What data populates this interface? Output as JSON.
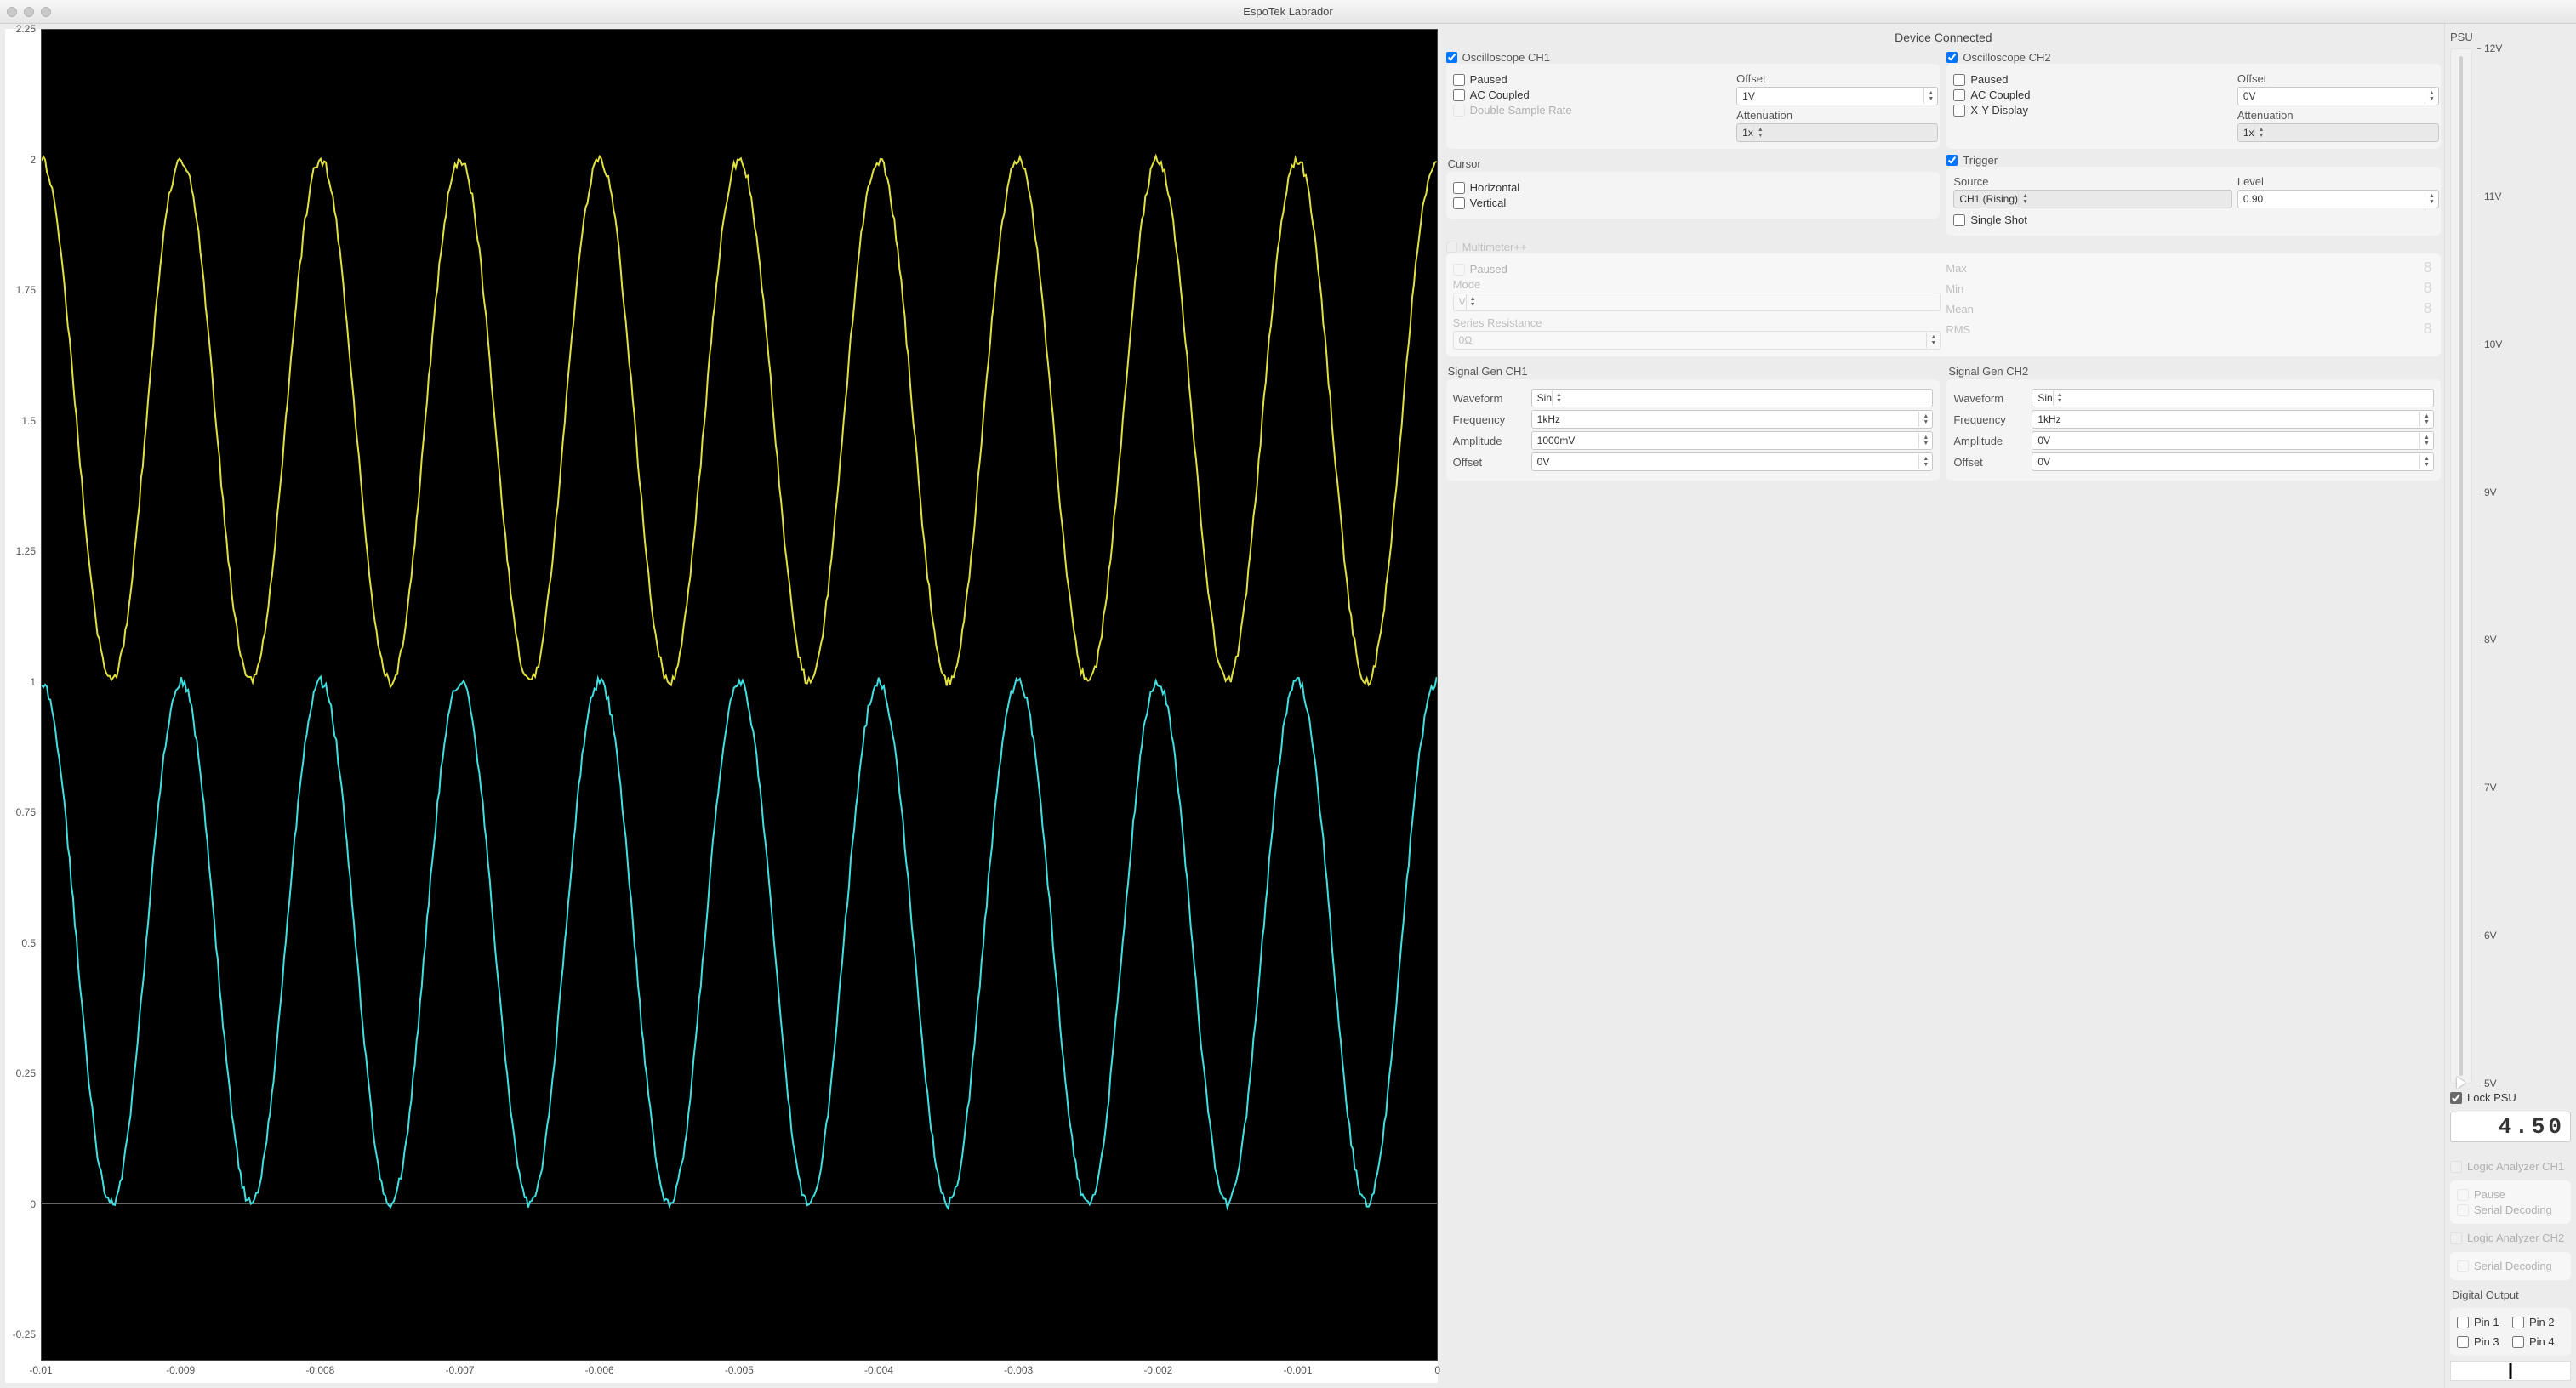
{
  "window": {
    "title": "EspoTek Labrador"
  },
  "status": "Device Connected",
  "scope": {
    "ch1": {
      "title": "Oscilloscope CH1",
      "enabled": true,
      "paused_label": "Paused",
      "ac_label": "AC Coupled",
      "dsr_label": "Double Sample Rate",
      "offset_label": "Offset",
      "offset": "1V",
      "atten_label": "Attenuation",
      "atten": "1x"
    },
    "ch2": {
      "title": "Oscilloscope CH2",
      "enabled": true,
      "paused_label": "Paused",
      "ac_label": "AC Coupled",
      "xy_label": "X-Y Display",
      "offset_label": "Offset",
      "offset": "0V",
      "atten_label": "Attenuation",
      "atten": "1x"
    }
  },
  "cursor": {
    "title": "Cursor",
    "horizontal": "Horizontal",
    "vertical": "Vertical"
  },
  "trigger": {
    "title": "Trigger",
    "enabled": true,
    "source_label": "Source",
    "source": "CH1 (Rising)",
    "level_label": "Level",
    "level": "0.90",
    "single_shot": "Single Shot"
  },
  "mm": {
    "title": "Multimeter++",
    "paused": "Paused",
    "mode_label": "Mode",
    "mode": "V",
    "series_label": "Series Resistance",
    "series": "0Ω",
    "max": "Max",
    "min": "Min",
    "mean": "Mean",
    "rms": "RMS",
    "digit": "8"
  },
  "sig": {
    "ch1": {
      "title": "Signal Gen CH1",
      "waveform_label": "Waveform",
      "waveform": "Sin",
      "freq_label": "Frequency",
      "freq": "1kHz",
      "amp_label": "Amplitude",
      "amp": "1000mV",
      "offset_label": "Offset",
      "offset": "0V"
    },
    "ch2": {
      "title": "Signal Gen CH2",
      "waveform_label": "Waveform",
      "waveform": "Sin",
      "freq_label": "Frequency",
      "freq": "1kHz",
      "amp_label": "Amplitude",
      "amp": "0V",
      "offset_label": "Offset",
      "offset": "0V"
    }
  },
  "psu": {
    "title": "PSU",
    "ticks": [
      "12V",
      "11V",
      "10V",
      "9V",
      "8V",
      "7V",
      "6V",
      "5V"
    ],
    "lock": "Lock PSU",
    "lcd": "4.50"
  },
  "la": {
    "ch1_title": "Logic Analyzer CH1",
    "pause": "Pause",
    "serial": "Serial Decoding",
    "ch2_title": "Logic Analyzer CH2"
  },
  "dout": {
    "title": "Digital Output",
    "p1": "Pin 1",
    "p2": "Pin 2",
    "p3": "Pin 3",
    "p4": "Pin 4"
  },
  "chart_data": {
    "type": "line",
    "xlabel": "",
    "ylabel": "",
    "xlim": [
      -0.01,
      0
    ],
    "ylim": [
      -0.3,
      2.25
    ],
    "x_ticks": [
      -0.01,
      -0.009,
      -0.008,
      -0.007,
      -0.006,
      -0.005,
      -0.004,
      -0.003,
      -0.002,
      -0.001,
      0
    ],
    "y_ticks": [
      -0.25,
      0,
      0.25,
      0.5,
      0.75,
      1,
      1.25,
      1.5,
      1.75,
      2,
      2.25
    ],
    "series": [
      {
        "name": "CH1",
        "color": "#e0e040",
        "wave": "sine",
        "freq_hz": 1000,
        "amplitude_v": 0.5,
        "offset_v": 1.5,
        "phase_cycles": 0.25
      },
      {
        "name": "CH2",
        "color": "#40e0e0",
        "wave": "sine",
        "freq_hz": 1000,
        "amplitude_v": 0.5,
        "offset_v": 0.5,
        "phase_cycles": 0.25
      }
    ]
  }
}
